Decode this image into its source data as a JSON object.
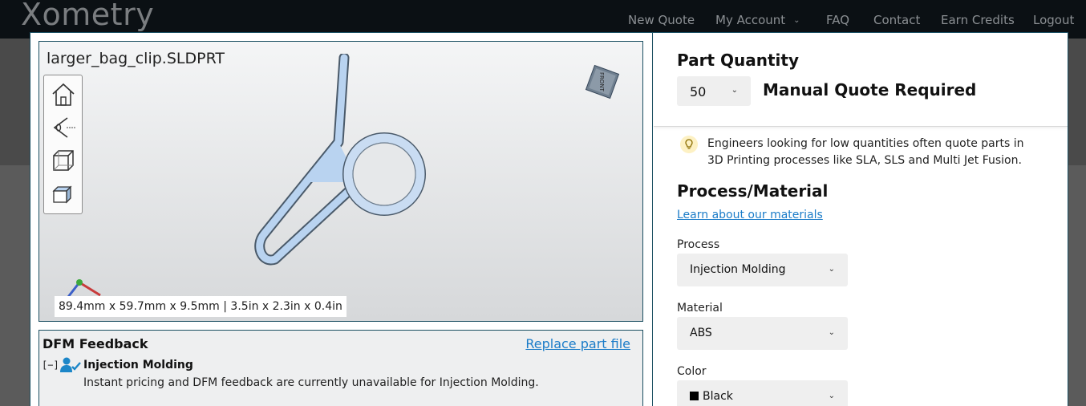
{
  "nav": {
    "logo": "Xometry",
    "items": [
      "New Quote",
      "My Account",
      "FAQ",
      "Contact",
      "Earn Credits",
      "Logout"
    ]
  },
  "viewer": {
    "file_name": "larger_bag_clip.SLDPRT",
    "dimensions": "89.4mm x 59.7mm x 9.5mm | 3.5in x 2.3in x 0.4in",
    "cube_label": "FRONT"
  },
  "dfm": {
    "title": "DFM Feedback",
    "replace_link": "Replace part file",
    "toggle": "[−]",
    "process": "Injection Molding",
    "message": "Instant pricing and DFM feedback are currently unavailable for Injection Molding."
  },
  "quantity": {
    "title": "Part Quantity",
    "value": "50",
    "status": "Manual Quote Required"
  },
  "tip": {
    "text": "Engineers looking for low quantities often quote parts in 3D Printing processes like SLA, SLS and Multi Jet Fusion."
  },
  "process_material": {
    "title": "Process/Material",
    "learn_link": "Learn about our materials",
    "process_label": "Process",
    "process_value": "Injection Molding",
    "material_label": "Material",
    "material_value": "ABS",
    "color_label": "Color",
    "color_value": "Black"
  },
  "colors": {
    "accent_link": "#1b7cc8",
    "modal_border": "#1b4f62",
    "part_fill": "#b9d3f0"
  }
}
